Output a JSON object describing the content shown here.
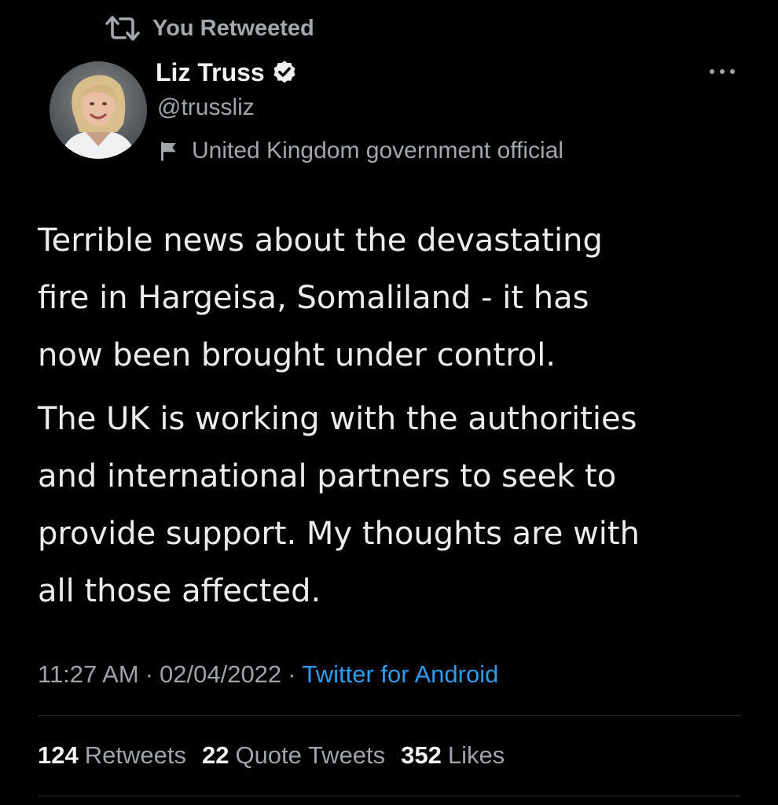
{
  "retweet_context": {
    "icon": "retweet-icon",
    "text": "You Retweeted"
  },
  "author": {
    "name": "Liz Truss",
    "verified_icon": "verified-badge-icon",
    "handle": "@trussliz",
    "label_icon": "flag-icon",
    "label": "United Kingdom government official"
  },
  "tweet": {
    "paragraph1_lines": [
      "Terrible news about the devastating",
      "fire in Hargeisa, Somaliland - it has",
      "now been brought under control."
    ],
    "paragraph2_lines": [
      "The UK is working with the authorities",
      "and international partners to seek to",
      "provide support. My thoughts are with",
      "all those affected."
    ]
  },
  "meta": {
    "time": "11:27 AM",
    "separator": "·",
    "date": "02/04/2022",
    "source": "Twitter for Android"
  },
  "stats": {
    "retweets_count": "124",
    "retweets_label": "Retweets",
    "quotes_count": "22",
    "quotes_label": "Quote Tweets",
    "likes_count": "352",
    "likes_label": "Likes"
  },
  "more_icon": "more-options-icon",
  "colors": {
    "background": "#000000",
    "primary_text": "#e7e9ea",
    "secondary_text": "#a0a6ac",
    "link": "#2d9cef"
  }
}
